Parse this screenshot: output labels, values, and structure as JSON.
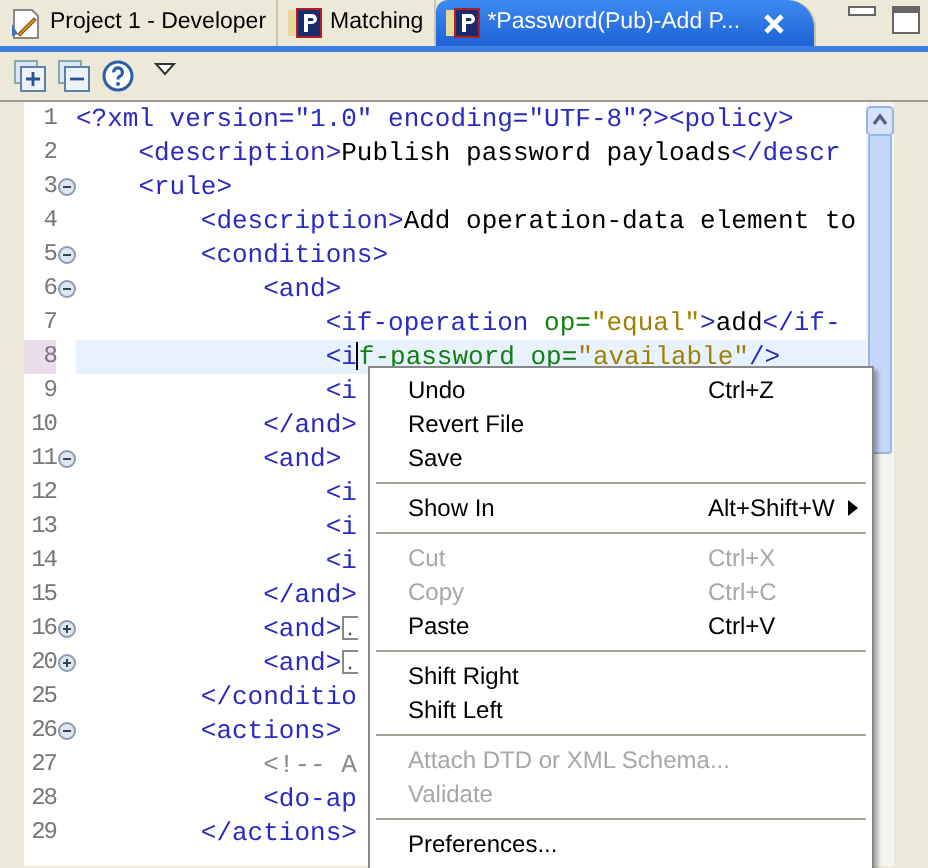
{
  "tabs": [
    {
      "label": "Project 1 - Developer",
      "selected": false
    },
    {
      "label": "Matching",
      "selected": false
    },
    {
      "label": "*Password(Pub)-Add P...",
      "selected": true,
      "closable": true
    }
  ],
  "toolbar": [
    {
      "kind": "expand"
    },
    {
      "kind": "collapse"
    },
    {
      "kind": "help"
    },
    {
      "kind": "menu"
    }
  ],
  "editor": {
    "lines": [
      {
        "number": "1",
        "current": false,
        "segments": [
          {
            "kind": "tag",
            "text": "<?xml version=\"1.0\" encoding=\"UTF-8\"?><policy>"
          }
        ],
        "children": [
          {
            "number": "2",
            "current": false,
            "segments": [
              {
                "kind": "tag",
                "text": "<description>"
              },
              {
                "kind": "text",
                "text": "Publish password payloads"
              },
              {
                "kind": "tag",
                "text": "</descr"
              }
            ]
          },
          {
            "number": "3",
            "current": false,
            "expanded": true,
            "segments": [
              {
                "kind": "tag",
                "text": "<rule>"
              }
            ],
            "children": [
              {
                "number": "4",
                "current": false,
                "segments": [
                  {
                    "kind": "tag",
                    "text": "<description>"
                  },
                  {
                    "kind": "text",
                    "text": "Add operation-data element to"
                  }
                ]
              },
              {
                "number": "5",
                "current": false,
                "expanded": true,
                "segments": [
                  {
                    "kind": "tag",
                    "text": "<conditions>"
                  }
                ],
                "children": [
                  {
                    "number": "6",
                    "current": false,
                    "expanded": true,
                    "segments": [
                      {
                        "kind": "tag",
                        "text": "<and>"
                      }
                    ],
                    "children": [
                      {
                        "number": "7",
                        "current": false,
                        "segments": [
                          {
                            "kind": "tag",
                            "text": "<if-operation "
                          },
                          {
                            "kind": "attr",
                            "text": "op="
                          },
                          {
                            "kind": "value",
                            "text": "\"equal\""
                          },
                          {
                            "kind": "tag",
                            "text": ">"
                          },
                          {
                            "kind": "text",
                            "text": "add"
                          },
                          {
                            "kind": "tag",
                            "text": "</if-"
                          }
                        ]
                      },
                      {
                        "number": "8",
                        "current": true,
                        "segments": [
                          {
                            "kind": "tag",
                            "text": "<i"
                          },
                          {
                            "kind": "caret"
                          },
                          {
                            "kind": "attr",
                            "text": "f-password op="
                          },
                          {
                            "kind": "value",
                            "text": "\"available\""
                          },
                          {
                            "kind": "tag",
                            "text": "/>"
                          }
                        ]
                      },
                      {
                        "number": "9",
                        "current": false,
                        "segments": [
                          {
                            "kind": "tag",
                            "text": "<i"
                          }
                        ]
                      }
                    ]
                  },
                  {
                    "number": "10",
                    "current": false,
                    "segments": [
                      {
                        "kind": "tag",
                        "text": "</and>"
                      }
                    ]
                  },
                  {
                    "number": "11",
                    "current": false,
                    "expanded": true,
                    "segments": [
                      {
                        "kind": "tag",
                        "text": "<and>"
                      }
                    ],
                    "children": [
                      {
                        "number": "12",
                        "current": false,
                        "segments": [
                          {
                            "kind": "tag",
                            "text": "<i"
                          }
                        ]
                      },
                      {
                        "number": "13",
                        "current": false,
                        "segments": [
                          {
                            "kind": "tag",
                            "text": "<i"
                          }
                        ]
                      },
                      {
                        "number": "14",
                        "current": false,
                        "segments": [
                          {
                            "kind": "tag",
                            "text": "<i"
                          }
                        ]
                      }
                    ]
                  },
                  {
                    "number": "15",
                    "current": false,
                    "segments": [
                      {
                        "kind": "tag",
                        "text": "</and>"
                      }
                    ]
                  },
                  {
                    "number": "16",
                    "current": false,
                    "expanded": false,
                    "segments": [
                      {
                        "kind": "tag",
                        "text": "<and>"
                      },
                      {
                        "kind": "folded"
                      }
                    ]
                  },
                  {
                    "number": "20",
                    "current": false,
                    "expanded": false,
                    "segments": [
                      {
                        "kind": "tag",
                        "text": "<and>"
                      },
                      {
                        "kind": "folded"
                      }
                    ]
                  }
                ]
              },
              {
                "number": "25",
                "current": false,
                "segments": [
                  {
                    "kind": "tag",
                    "text": "</conditio"
                  }
                ]
              },
              {
                "number": "26",
                "current": false,
                "expanded": true,
                "segments": [
                  {
                    "kind": "tag",
                    "text": "<actions>"
                  }
                ],
                "children": [
                  {
                    "number": "27",
                    "current": false,
                    "segments": [
                      {
                        "kind": "comment",
                        "text": "<!-- A"
                      }
                    ]
                  },
                  {
                    "number": "28",
                    "current": false,
                    "segments": [
                      {
                        "kind": "tag",
                        "text": "<do-ap"
                      }
                    ]
                  }
                ]
              },
              {
                "number": "29",
                "current": false,
                "segments": [
                  {
                    "kind": "tag",
                    "text": "</actions>"
                  }
                ]
              }
            ]
          }
        ]
      }
    ]
  },
  "context_menu": [
    {
      "kind": "item",
      "label": "Undo",
      "shortcut": "Ctrl+Z",
      "disabled": false
    },
    {
      "kind": "item",
      "label": "Revert File",
      "disabled": false
    },
    {
      "kind": "item",
      "label": "Save",
      "disabled": false
    },
    {
      "kind": "separator"
    },
    {
      "kind": "item",
      "label": "Show In",
      "shortcut": "Alt+Shift+W",
      "disabled": false,
      "submenu": true
    },
    {
      "kind": "separator"
    },
    {
      "kind": "item",
      "label": "Cut",
      "shortcut": "Ctrl+X",
      "disabled": true
    },
    {
      "kind": "item",
      "label": "Copy",
      "shortcut": "Ctrl+C",
      "disabled": true
    },
    {
      "kind": "item",
      "label": "Paste",
      "shortcut": "Ctrl+V",
      "disabled": false
    },
    {
      "kind": "separator"
    },
    {
      "kind": "item",
      "label": "Shift Right",
      "disabled": false
    },
    {
      "kind": "item",
      "label": "Shift Left",
      "disabled": false
    },
    {
      "kind": "separator"
    },
    {
      "kind": "item",
      "label": "Attach DTD or XML Schema...",
      "disabled": true
    },
    {
      "kind": "item",
      "label": "Validate",
      "disabled": true
    },
    {
      "kind": "separator"
    },
    {
      "kind": "item",
      "label": "Preferences...",
      "disabled": false
    }
  ]
}
